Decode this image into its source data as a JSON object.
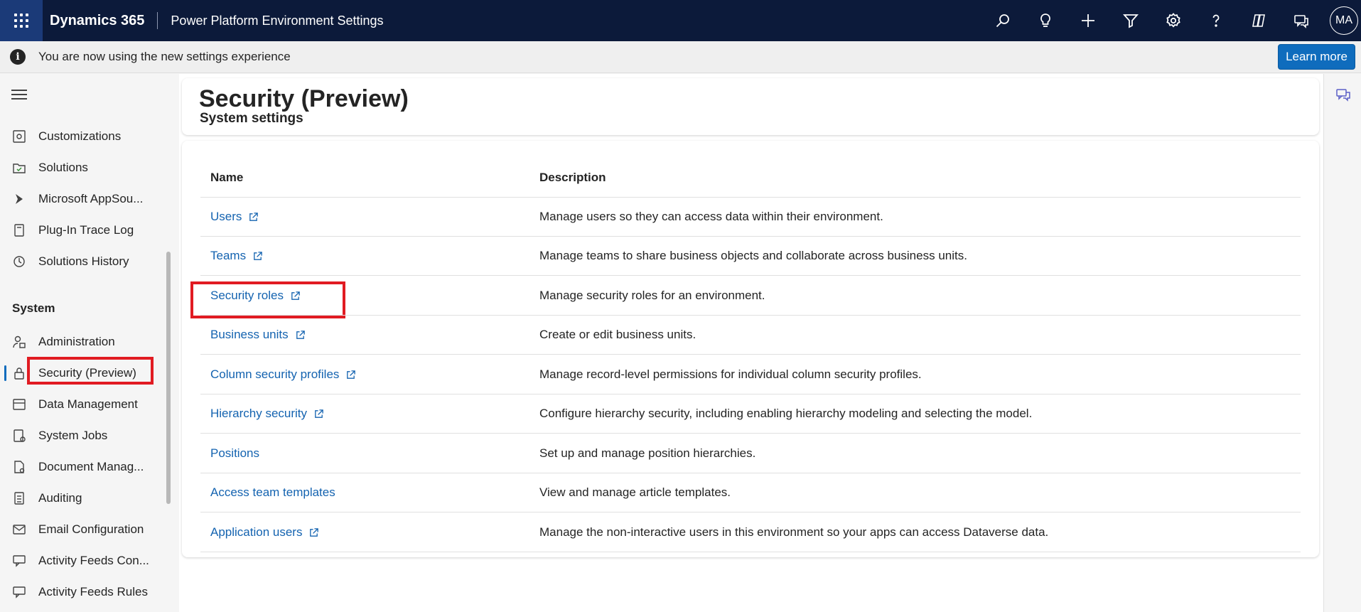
{
  "topbar": {
    "app_name": "Dynamics 365",
    "environment": "Power Platform Environment Settings",
    "avatar_initials": "MA",
    "icons": [
      "search-icon",
      "lightbulb-icon",
      "plus-icon",
      "filter-icon",
      "settings-icon",
      "help-icon",
      "copilot-icon",
      "feedback-icon"
    ]
  },
  "notice": {
    "text": "You are now using the new settings experience",
    "button": "Learn more"
  },
  "sidebar": {
    "items_top": [
      {
        "label": "Customizations",
        "icon": "puzzle-icon"
      },
      {
        "label": "Solutions",
        "icon": "solutions-icon"
      },
      {
        "label": "Microsoft AppSou...",
        "icon": "appsource-icon"
      },
      {
        "label": "Plug-In Trace Log",
        "icon": "trace-log-icon"
      },
      {
        "label": "Solutions History",
        "icon": "history-icon"
      }
    ],
    "section": "System",
    "items_system": [
      {
        "label": "Administration",
        "icon": "admin-icon"
      },
      {
        "label": "Security (Preview)",
        "icon": "lock-icon",
        "selected": true
      },
      {
        "label": "Data Management",
        "icon": "data-icon"
      },
      {
        "label": "System Jobs",
        "icon": "jobs-icon"
      },
      {
        "label": "Document Manag...",
        "icon": "document-icon"
      },
      {
        "label": "Auditing",
        "icon": "audit-icon"
      },
      {
        "label": "Email Configuration",
        "icon": "mail-icon"
      },
      {
        "label": "Activity Feeds Con...",
        "icon": "feeds-icon"
      },
      {
        "label": "Activity Feeds Rules",
        "icon": "feeds-rules-icon"
      }
    ]
  },
  "page": {
    "title": "Security (Preview)",
    "subtitle": "System settings"
  },
  "table": {
    "columns": [
      "Name",
      "Description"
    ],
    "rows": [
      {
        "name": "Users",
        "external": true,
        "description": "Manage users so they can access data within their environment."
      },
      {
        "name": "Teams",
        "external": true,
        "description": "Manage teams to share business objects and collaborate across business units."
      },
      {
        "name": "Security roles",
        "external": true,
        "description": "Manage security roles for an environment."
      },
      {
        "name": "Business units",
        "external": true,
        "description": "Create or edit business units."
      },
      {
        "name": "Column security profiles",
        "external": true,
        "description": "Manage record-level permissions for individual column security profiles."
      },
      {
        "name": "Hierarchy security",
        "external": true,
        "description": "Configure hierarchy security, including enabling hierarchy modeling and selecting the model."
      },
      {
        "name": "Positions",
        "external": false,
        "description": "Set up and manage position hierarchies."
      },
      {
        "name": "Access team templates",
        "external": false,
        "description": "View and manage article templates."
      },
      {
        "name": "Application users",
        "external": true,
        "description": "Manage the non-interactive users in this environment so your apps can access Dataverse data."
      }
    ]
  },
  "colors": {
    "topbar": "#0c1a3a",
    "accent": "#0f6cbd",
    "link": "#1463b0",
    "highlight": "#e11b22"
  }
}
